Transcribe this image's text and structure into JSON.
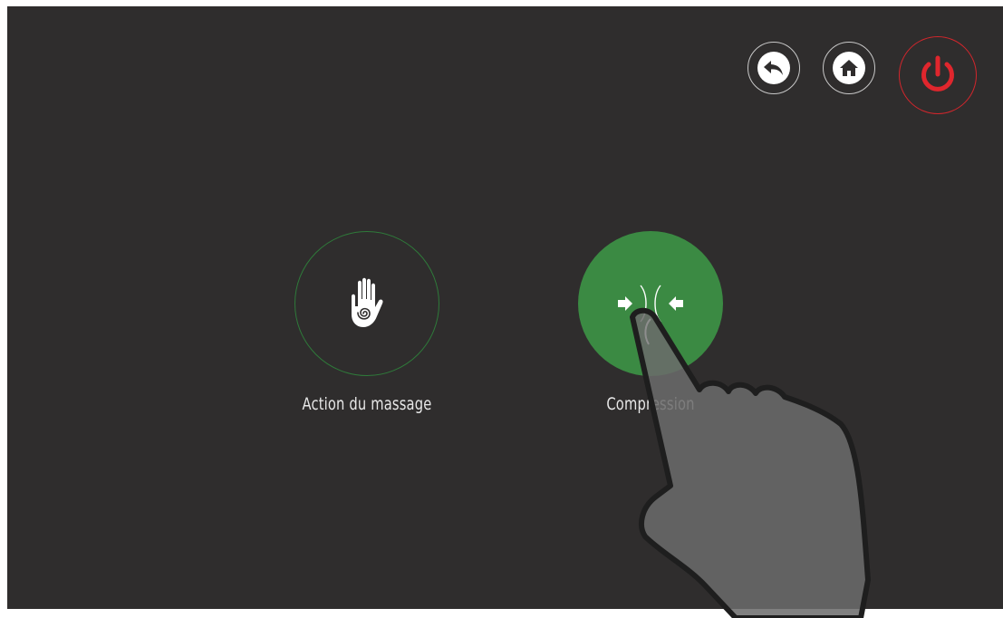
{
  "toolbar": {
    "back_icon": "undo-arrow-icon",
    "home_icon": "home-icon",
    "power_icon": "power-icon",
    "power_color": "#e0262d"
  },
  "modes": [
    {
      "label": "Action du massage",
      "icon": "hand-spiral-icon",
      "selected": false
    },
    {
      "label": "Compression",
      "icon": "compression-arrows-icon",
      "selected": true
    }
  ],
  "colors": {
    "background": "#2f2d2d",
    "accent_green": "#3b8a43",
    "power_red": "#e0262d"
  }
}
